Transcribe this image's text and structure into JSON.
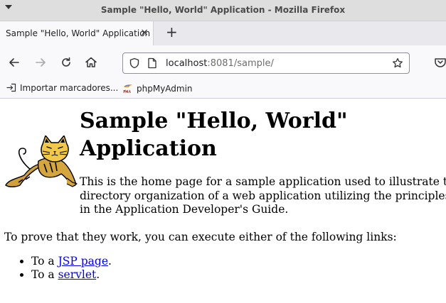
{
  "window": {
    "title": "Sample \"Hello, World\" Application - Mozilla Firefox"
  },
  "tabs": [
    {
      "label": "Sample \"Hello, World\" Application",
      "close": "×"
    }
  ],
  "newtab": "+",
  "urlbar": {
    "host": "localhost",
    "rest": ":8081/sample/"
  },
  "bookmarks": [
    {
      "label": "Importar marcadores..."
    },
    {
      "label": "phpMyAdmin"
    }
  ],
  "page": {
    "heading": "Sample \"Hello, World\" Application",
    "intro": "This is the home page for a sample application used to illustrate the source directory organization of a web application utilizing the principles outlined in the Application Developer's Guide.",
    "prove": "To prove that they work, you can execute either of the following links:",
    "links": [
      {
        "prefix": "To a ",
        "text": "JSP page",
        "suffix": "."
      },
      {
        "prefix": "To a ",
        "text": "servlet",
        "suffix": "."
      }
    ]
  }
}
